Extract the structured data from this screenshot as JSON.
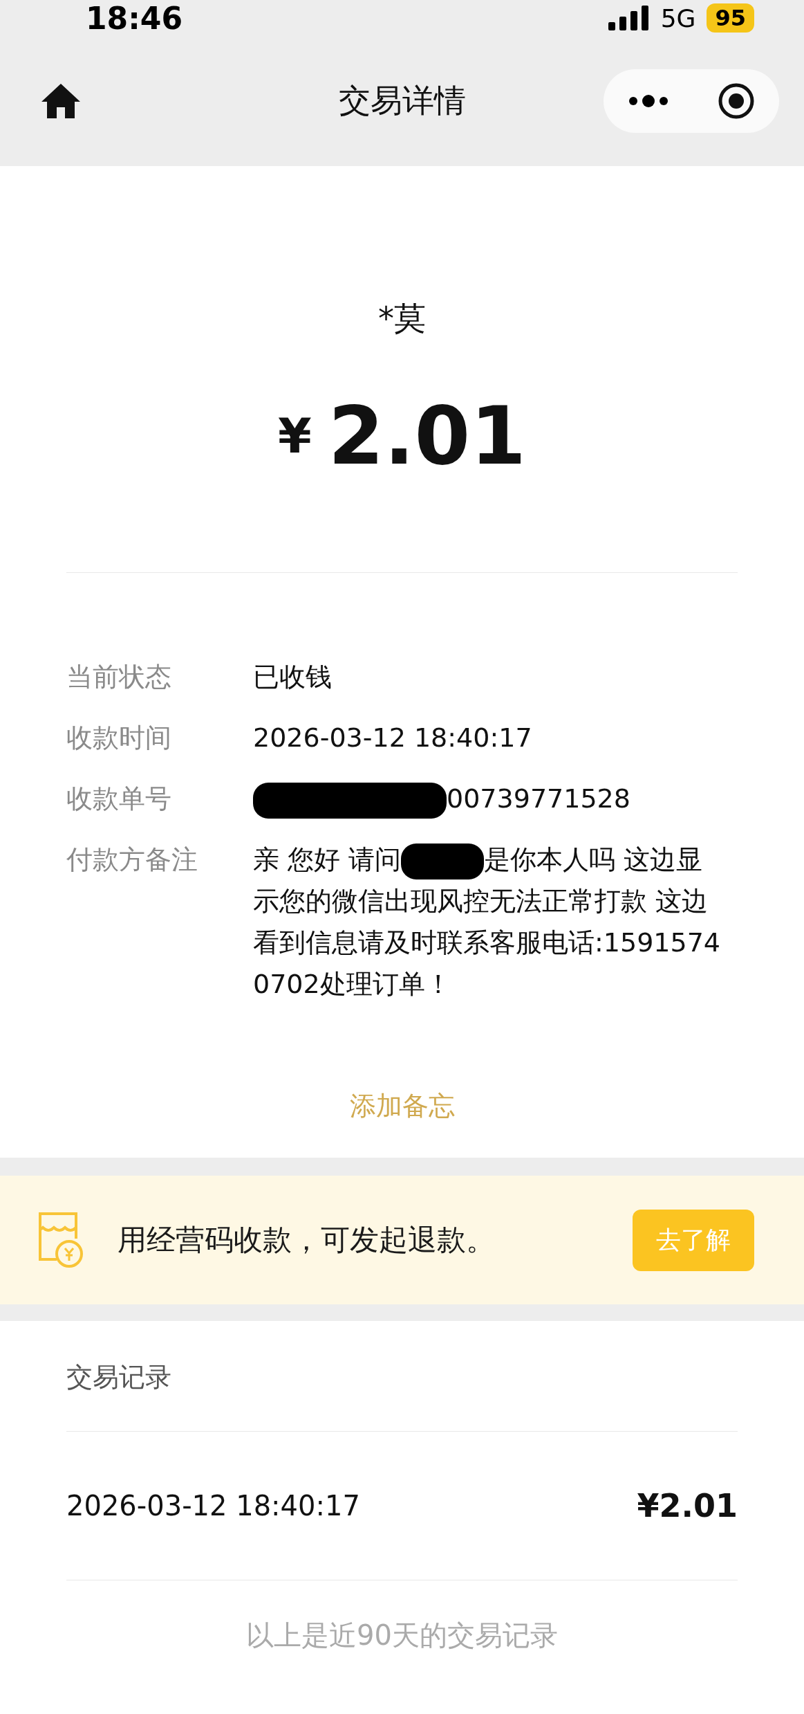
{
  "status_bar": {
    "time": "18:46",
    "network": "5G",
    "battery": "95"
  },
  "nav": {
    "title": "交易详情"
  },
  "payee": {
    "name": "*莫",
    "currency": "¥",
    "amount": "2.01"
  },
  "details": [
    {
      "kind": "text",
      "label": "当前状态",
      "value": "已收钱"
    },
    {
      "kind": "text",
      "label": "收款时间",
      "value": "2026-03-12 18:40:17"
    },
    {
      "kind": "redacted",
      "label": "收款单号",
      "after": "00739771528"
    },
    {
      "kind": "redacted",
      "label": "付款方备注",
      "before": "亲 您好 请问",
      "after": "是你本人吗 这边显示您的微信出现风控无法正常打款 这边看到信息请及时联系客服电话:15915740702处理订单！"
    }
  ],
  "add_note": "添加备忘",
  "banner": {
    "text": "用经营码收款，可发起退款。",
    "button": "去了解"
  },
  "records": {
    "title": "交易记录",
    "rows": [
      {
        "time": "2026-03-12 18:40:17",
        "amount": "¥2.01"
      }
    ],
    "footer": "以上是近90天的交易记录"
  }
}
